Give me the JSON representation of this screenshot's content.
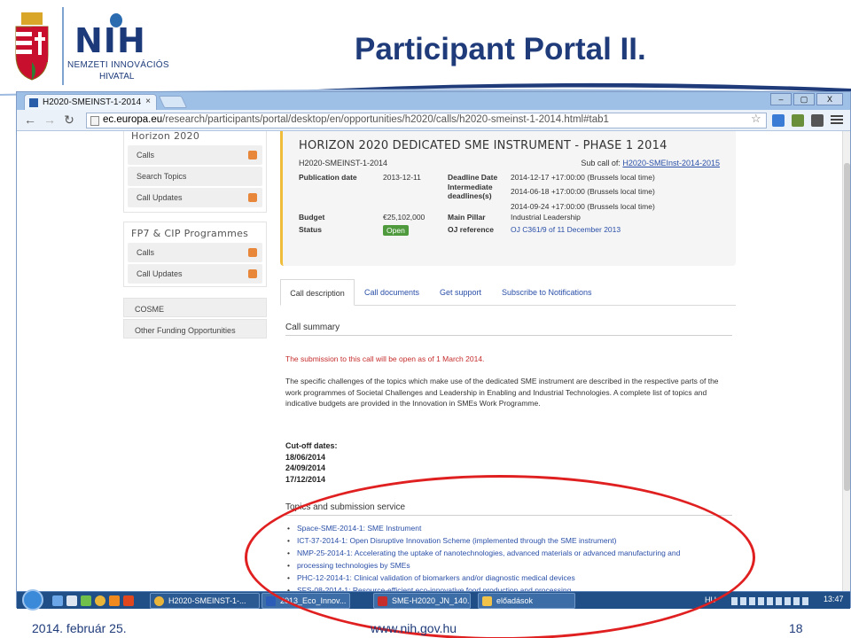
{
  "slide": {
    "title": "Participant Portal II.",
    "logo": {
      "name": "NIH",
      "line1": "NEMZETI INNOVÁCIÓS",
      "line2": "HIVATAL"
    },
    "footer": {
      "date": "2014. február 25.",
      "url": "www.nih.gov.hu",
      "page": "18"
    }
  },
  "browser": {
    "tab_title": "H2020-SMEINST-1-2014",
    "url_domain": "ec.europa.eu",
    "url_path": "/research/participants/portal/desktop/en/opportunities/h2020/calls/h2020-smeinst-1-2014.html#tab1",
    "window_buttons": [
      "–",
      "▢",
      "X"
    ]
  },
  "sidebar": {
    "horizon_title": "Horizon 2020",
    "horizon_items": [
      "Calls",
      "Search Topics",
      "Call Updates"
    ],
    "fp7_title": "FP7 & CIP Programmes",
    "fp7_items": [
      "Calls",
      "Call Updates"
    ],
    "cosme": "COSME",
    "other": "Other Funding Opportunities"
  },
  "call": {
    "heading": "HORIZON 2020 DEDICATED SME INSTRUMENT - PHASE 1 2014",
    "id": "H2020-SMEINST-1-2014",
    "subcall_label": "Sub call of:",
    "subcall_link": "H2020-SMEInst-2014-2015",
    "publication_label": "Publication date",
    "publication_value": "2013-12-11",
    "deadline_label": "Deadline Date",
    "deadline_value": "2014-12-17 +17:00:00 (Brussels local time)",
    "intermediate_label1": "Intermediate",
    "intermediate_label2": "deadlines(s)",
    "intermediate_value1": "2014-06-18 +17:00:00 (Brussels local time)",
    "intermediate_value2": "2014-09-24 +17:00:00 (Brussels local time)",
    "budget_label": "Budget",
    "budget_value": "€25,102,000",
    "pillar_label": "Main Pillar",
    "pillar_value": "Industrial Leadership",
    "status_label": "Status",
    "status_value": "Open",
    "oj_label": "OJ reference",
    "oj_value": "OJ C361/9 of 11 December 2013"
  },
  "tabs": [
    "Call description",
    "Call documents",
    "Get support",
    "Subscribe to Notifications"
  ],
  "description": {
    "summary_title": "Call summary",
    "red_note": "The submission to this call will be open as of 1 March 2014.",
    "paragraph": "The specific challenges of the topics which make use of the dedicated SME instrument are described in the respective parts of the work programmes of Societal Challenges and Leadership in Enabling and Industrial Technologies. A complete list of topics and indicative budgets are provided in the Innovation in SMEs Work Programme.",
    "cutoff_title": "Cut-off dates:",
    "cutoff_dates": [
      "18/06/2014",
      "24/09/2014",
      "17/12/2014"
    ],
    "topics_title": "Topics and submission service",
    "topics": [
      "Space-SME-2014-1: SME Instrument",
      "ICT-37-2014-1: Open Disruptive Innovation Scheme (implemented through the SME instrument)",
      "NMP-25-2014-1: Accelerating the uptake of nanotechnologies, advanced materials or advanced manufacturing and",
      "processing technologies by SMEs",
      "PHC-12-2014-1: Clinical validation of biomarkers and/or diagnostic medical devices",
      "SFS-08-2014-1: Resource-efficient eco-innovative food production and processing"
    ]
  },
  "taskbar": {
    "buttons": [
      "H2020-SMEINST-1-...",
      "2013_Eco_Innov...",
      "SME-H2020_JN_140...",
      "előadások"
    ],
    "clock": "13:47",
    "lang": "HU"
  },
  "colors": {
    "title_blue": "#1f3b7a",
    "link_blue": "#2a4fa8",
    "red_note": "#c62d2d",
    "highlight_ellipse": "#e02020",
    "status_green": "#4f9a3c"
  }
}
